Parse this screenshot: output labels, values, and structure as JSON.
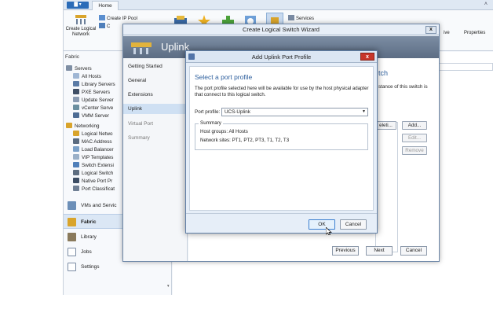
{
  "console": {
    "file_menu": "",
    "home_tab": "Home",
    "ribbon": {
      "create_ip_pool": "Create IP Pool",
      "create_prefix": "C",
      "services": "Services",
      "create_logical_network": "Create Logical\nNetwork",
      "properties": "Properties",
      "ive": "ive"
    },
    "nav": {
      "header": "Fabric",
      "tree": [
        {
          "label": "Servers",
          "indent": 0
        },
        {
          "label": "All Hosts",
          "indent": 1
        },
        {
          "label": "Library Servers",
          "indent": 1
        },
        {
          "label": "PXE Servers",
          "indent": 1
        },
        {
          "label": "Update Server",
          "indent": 1
        },
        {
          "label": "vCenter Serve",
          "indent": 1
        },
        {
          "label": "VMM Server",
          "indent": 1
        },
        {
          "label": "Networking",
          "indent": 0
        },
        {
          "label": "Logical Netwo",
          "indent": 1
        },
        {
          "label": "MAC Address",
          "indent": 1
        },
        {
          "label": "Load Balancer",
          "indent": 1
        },
        {
          "label": "VIP Templates",
          "indent": 1
        },
        {
          "label": "Switch Extensi",
          "indent": 1
        },
        {
          "label": "Logical Switch",
          "indent": 1
        },
        {
          "label": "Native Port Pr",
          "indent": 1
        },
        {
          "label": "Port Classificat",
          "indent": 1
        }
      ],
      "workspaces": [
        {
          "label": "VMs and Servic"
        },
        {
          "label": "Fabric"
        },
        {
          "label": "Library"
        },
        {
          "label": "Jobs"
        },
        {
          "label": "Settings"
        }
      ]
    }
  },
  "wizard": {
    "title": "Create Logical Switch Wizard",
    "banner_title": "Uplink",
    "steps": [
      "Getting Started",
      "General",
      "Extensions",
      "Uplink",
      "Virtual Port",
      "Summary"
    ],
    "body_title": "tch",
    "body_text": "stance of this switch is",
    "btn_add": "Add...",
    "btn_edit": "Edit...",
    "btn_remove": "Remove",
    "btn_delete": "eleti...",
    "footer": {
      "previous": "Previous",
      "next": "Next",
      "cancel": "Cancel"
    }
  },
  "dialog": {
    "title": "Add Uplink Port Profile",
    "heading": "Select a port profile",
    "description": "The port profile selected here will be available for use by the host physical adapter that connect to this logical switch.",
    "port_profile_label": "Port profile:",
    "port_profile_value": "UCS-Uplink",
    "summary_legend": "Summary",
    "host_groups": "Host groups:  All Hosts",
    "network_sites": "Network sites: PT1, PT2, PT3, T1, T2, T3",
    "ok": "OK",
    "cancel": "Cancel"
  }
}
